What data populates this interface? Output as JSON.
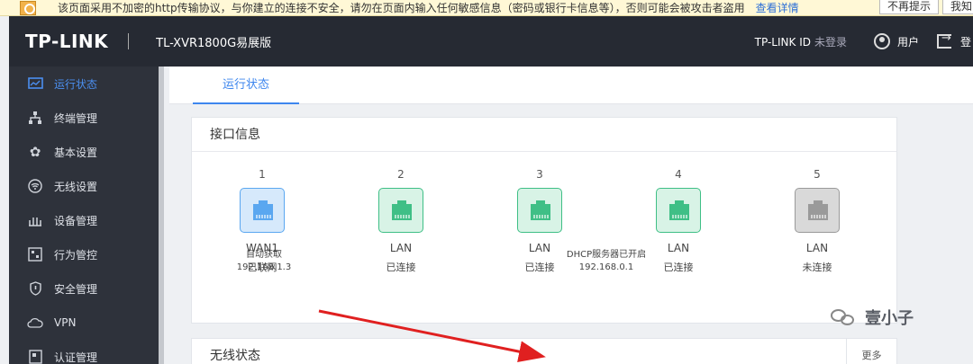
{
  "warning": {
    "text": "该页面采用不加密的http传输协议，与你建立的连接不安全，请勿在页面内输入任何敏感信息（密码或银行卡信息等），否则可能会被攻击者盗用",
    "link": "查看详情",
    "btn_no_remind": "不再提示",
    "btn_ok": "我知"
  },
  "header": {
    "logo": "TP-LINK",
    "model": "TL-XVR1800G易展版",
    "tplink_id": "TP-LINK ID",
    "tplink_id_status": "未登录",
    "user": "用户",
    "logout": "登"
  },
  "sidebar": {
    "items": [
      {
        "label": "运行状态",
        "icon": "monitor-icon"
      },
      {
        "label": "终端管理",
        "icon": "network-tree-icon"
      },
      {
        "label": "基本设置",
        "icon": "gear-icon"
      },
      {
        "label": "无线设置",
        "icon": "wifi-icon"
      },
      {
        "label": "设备管理",
        "icon": "device-icon"
      },
      {
        "label": "行为管控",
        "icon": "control-icon"
      },
      {
        "label": "安全管理",
        "icon": "shield-icon"
      },
      {
        "label": "VPN",
        "icon": "vpn-cloud-icon"
      },
      {
        "label": "认证管理",
        "icon": "auth-icon"
      }
    ]
  },
  "main": {
    "tab": "运行状态",
    "interface_card": {
      "title": "接口信息",
      "ports": [
        {
          "num": "1",
          "type": "WAN1",
          "status": "已联网",
          "color": "#5aa7f0"
        },
        {
          "num": "2",
          "type": "LAN",
          "status": "已连接",
          "color": "#3fbf86"
        },
        {
          "num": "3",
          "type": "LAN",
          "status": "已连接",
          "color": "#3fbf86"
        },
        {
          "num": "4",
          "type": "LAN",
          "status": "已连接",
          "color": "#3fbf86"
        },
        {
          "num": "5",
          "type": "LAN",
          "status": "未连接",
          "color": "#9a9a9a"
        }
      ],
      "wan_mode": "自动获取",
      "wan_ip": "192.168.1.3",
      "dhcp_status": "DHCP服务器已开启",
      "lan_ip": "192.168.0.1"
    },
    "wireless_card": {
      "title": "无线状态",
      "more": "更多"
    }
  },
  "watermark": "壹小子",
  "colors": {
    "header_bg": "#262a33",
    "sidebar_bg": "#2e323b",
    "accent": "#3d86ee",
    "arrow": "#e02020"
  }
}
